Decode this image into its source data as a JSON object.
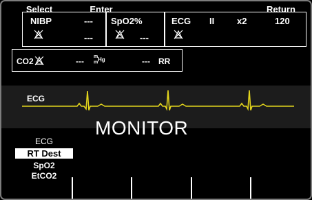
{
  "vitals": {
    "nibp": {
      "label": "NIBP",
      "value": "---",
      "value2": "---",
      "alarm_icon": "alarm-off-icon"
    },
    "spo2": {
      "label": "SpO2%",
      "value": "---",
      "alarm_icon": "alarm-off-icon"
    },
    "ecg": {
      "label": "ECG",
      "lead": "II",
      "gain": "x2",
      "hr": "120",
      "alarm_icon": "alarm-off-icon"
    },
    "co2": {
      "label": "CO2",
      "value": "---",
      "unit_top": "m",
      "unit_bottom": "m",
      "unit_side": "Hg",
      "rr_value": "---",
      "rr_label": "RR",
      "alarm_icon": "alarm-off-icon"
    }
  },
  "waveform": {
    "label": "ECG",
    "color": "#e2d41c"
  },
  "mode_title": "MONITOR",
  "menu": {
    "items": [
      "ECG",
      "RT Dest",
      "SpO2",
      "EtCO2"
    ],
    "selected_index": 1
  },
  "softkeys": [
    "Select",
    "Enter",
    "",
    "",
    "Return"
  ],
  "colors": {
    "background": "#000000",
    "foreground": "#ffffff",
    "frame": "#7d7d7d",
    "waveform": "#e2d41c",
    "band": "#1c1c1c"
  }
}
